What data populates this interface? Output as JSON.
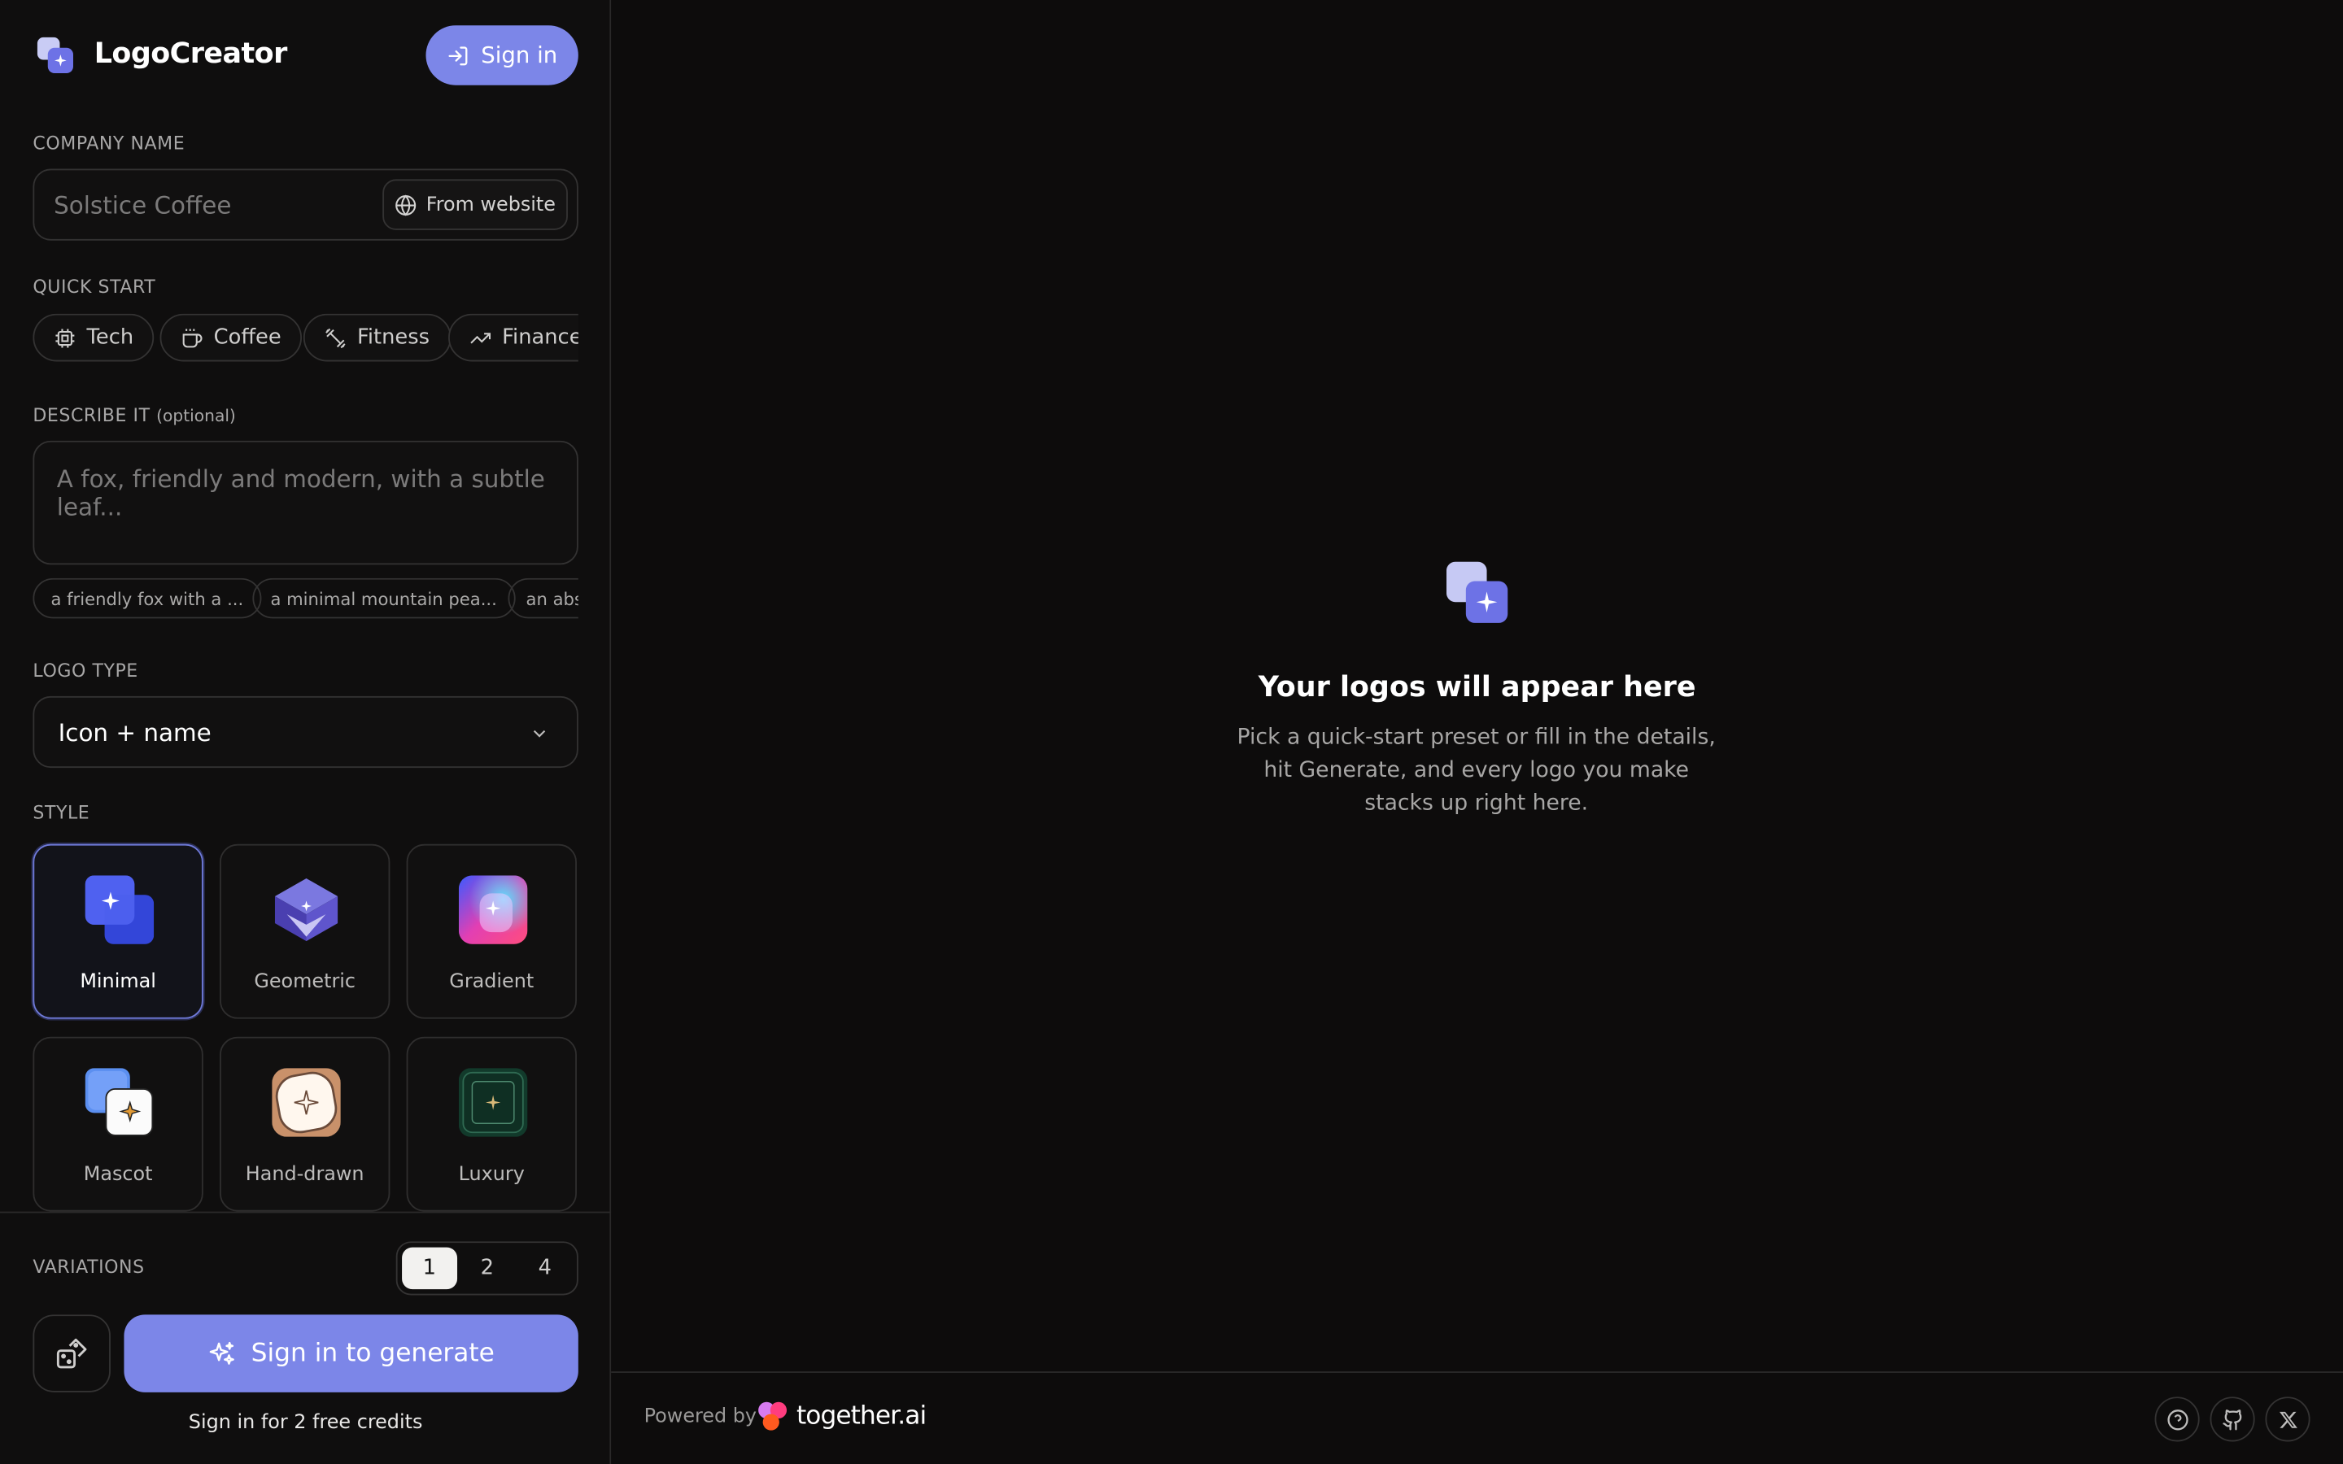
{
  "app": {
    "brand": "LogoCreator",
    "signin_label": "Sign in"
  },
  "company": {
    "label": "COMPANY NAME",
    "placeholder": "Solstice Coffee",
    "from_website": "From website"
  },
  "quick_start": {
    "label": "QUICK START",
    "presets": [
      {
        "label": "Tech",
        "icon": "cpu-icon"
      },
      {
        "label": "Coffee",
        "icon": "coffee-cup-icon"
      },
      {
        "label": "Fitness",
        "icon": "dumbbell-icon"
      },
      {
        "label": "Finance",
        "icon": "trending-up-icon"
      }
    ]
  },
  "describe": {
    "label": "DESCRIBE IT",
    "optional": "(optional)",
    "placeholder": "A fox, friendly and modern, with a subtle leaf...",
    "suggestions": [
      "a friendly fox with a ...",
      "a minimal mountain pea...",
      "an abs"
    ]
  },
  "logo_type": {
    "label": "LOGO TYPE",
    "value": "Icon + name"
  },
  "style": {
    "label": "STYLE",
    "options": [
      "Minimal",
      "Geometric",
      "Gradient",
      "Mascot",
      "Hand-drawn",
      "Luxury"
    ],
    "selected": "Minimal"
  },
  "variations": {
    "label": "VARIATIONS",
    "options": [
      "1",
      "2",
      "4"
    ],
    "selected": "1"
  },
  "generate": {
    "label": "Sign in to generate",
    "credits_note": "Sign in for 2 free credits"
  },
  "empty_state": {
    "title": "Your logos will appear here",
    "description": "Pick a quick-start preset or fill in the details, hit Generate, and every logo you make stacks up right here."
  },
  "footer": {
    "powered_by": "Powered by",
    "partner": "together.ai",
    "icons": [
      "help-icon",
      "github-icon",
      "x-icon"
    ]
  },
  "colors": {
    "accent": "#7c86e8",
    "background": "#0e0d0d",
    "border": "#333232"
  }
}
